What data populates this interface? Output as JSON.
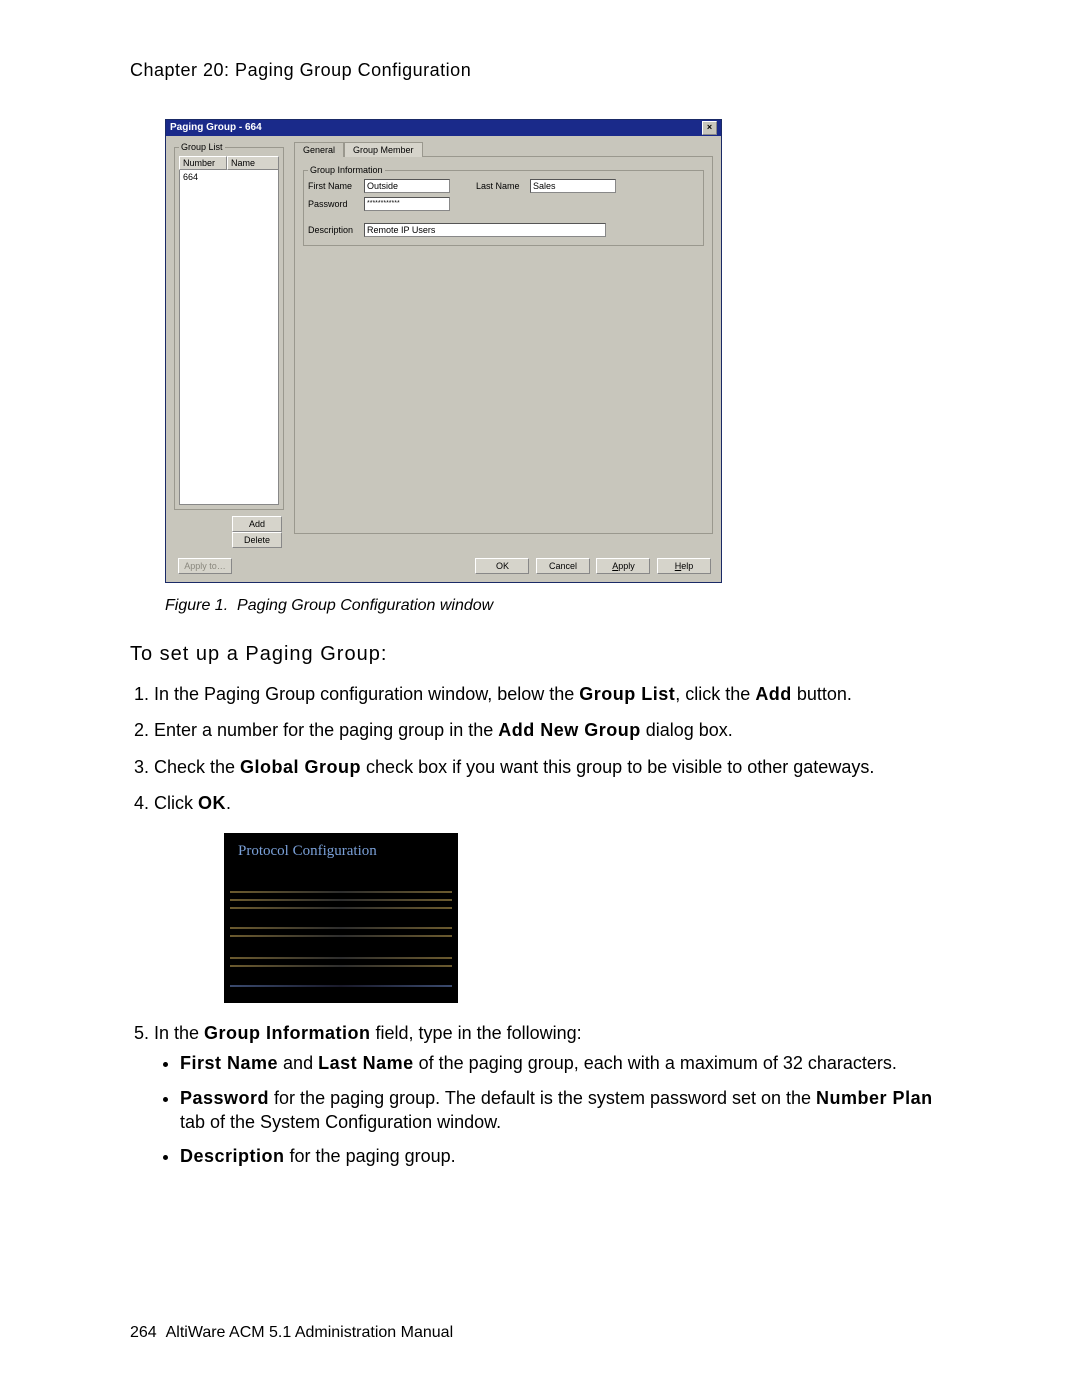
{
  "chapter_header": "Chapter 20:  Paging Group Configuration",
  "dialog": {
    "title": "Paging Group - 664",
    "group_list_legend": "Group List",
    "col_number": "Number",
    "col_name": "Name",
    "row_number": "664",
    "btn_add": "Add",
    "btn_delete": "Delete",
    "btn_apply_to": "Apply to…",
    "tab_general": "General",
    "tab_member": "Group Member",
    "gi_legend": "Group Information",
    "lbl_first": "First Name",
    "val_first": "Outside",
    "lbl_last": "Last Name",
    "val_last": "Sales",
    "lbl_pwd": "Password",
    "val_pwd": "************",
    "lbl_desc": "Description",
    "val_desc": "Remote IP Users",
    "btn_ok": "OK",
    "btn_cancel": "Cancel",
    "btn_apply": "Apply",
    "btn_help": "Help"
  },
  "figcaption": {
    "label": "Figure 1.",
    "text": "Paging Group Configuration window"
  },
  "heading": "To set up a Paging Group:",
  "steps": {
    "s1a": "In the Paging Group configuration window, below the ",
    "s1b": "Group List",
    "s1c": ", click the ",
    "s1d": "Add",
    "s1e": " button.",
    "s2a": "Enter a number for the paging group in the ",
    "s2b": "Add New Group",
    "s2c": " dialog box.",
    "s3a": "Check the ",
    "s3b": "Global Group",
    "s3c": " check box if you want this group to be visible to other gateways.",
    "s4a": "Click ",
    "s4b": "OK",
    "s4c": ".",
    "s5a": "In the ",
    "s5b": "Group Information",
    "s5c": " field, type in the following:",
    "b1a": "First Name",
    "b1b": " and ",
    "b1c": "Last Name",
    "b1d": " of the paging group, each with a maximum of 32 characters.",
    "b2a": "Password",
    "b2b": " for the paging group. The default is the system password set on the ",
    "b2c": "Number Plan",
    "b2d": " tab of the System Configuration window.",
    "b3a": "Description",
    "b3b": " for the paging group."
  },
  "shot2_title": "Protocol Configuration",
  "footer": {
    "page": "264",
    "text": "AltiWare ACM 5.1 Administration Manual"
  }
}
